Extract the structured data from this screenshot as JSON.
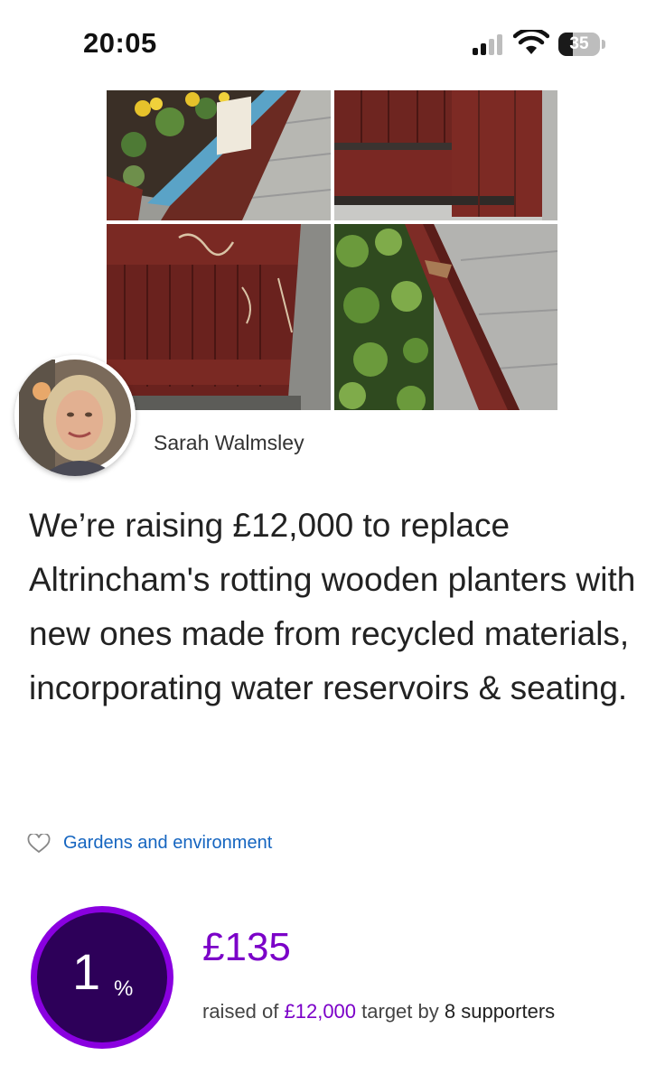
{
  "status_bar": {
    "time": "20:05",
    "battery_level": "35",
    "battery_fraction": 0.35
  },
  "collage": {
    "photos": [
      {
        "name": "planter-with-daffodils-photo"
      },
      {
        "name": "planter-corner-rot-photo"
      },
      {
        "name": "planter-side-scratched-photo"
      },
      {
        "name": "planter-edge-with-ivy-photo"
      }
    ]
  },
  "author": {
    "name": "Sarah Walmsley"
  },
  "headline": "We’re raising £12,000 to replace Altrincham's rotting wooden planters with new ones made from recycled materials, incorporating water reservoirs & seating.",
  "category": {
    "icon": "heart-outline-icon",
    "label": "Gardens and environment"
  },
  "funding": {
    "percent": "1",
    "percent_symbol": "%",
    "progress_fraction": 0.01,
    "raised": "£135",
    "raised_prefix": "raised of ",
    "target": "£12,000",
    "target_suffix": " target by ",
    "supporters": "8 supporters"
  },
  "colors": {
    "accent": "#7b00c8",
    "ring_fill": "#2d0059",
    "link": "#1565c0"
  }
}
